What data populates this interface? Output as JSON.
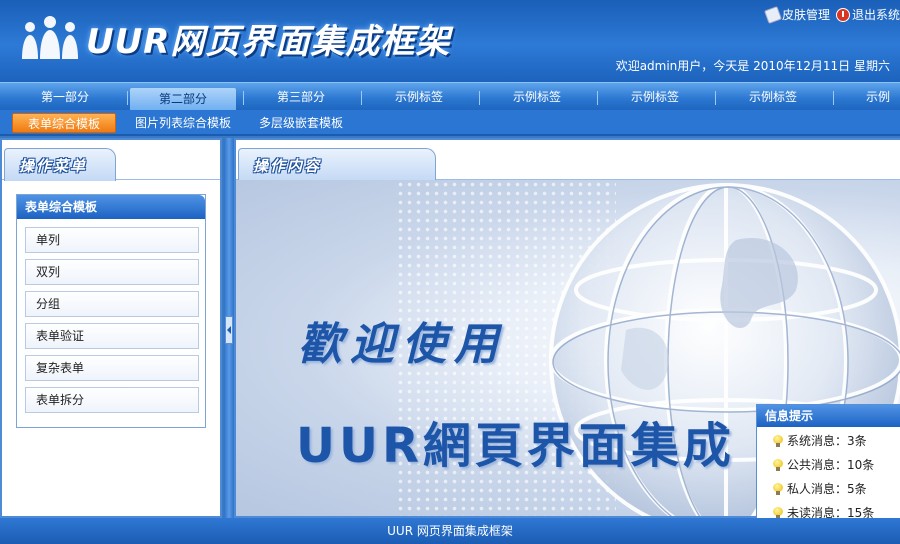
{
  "header": {
    "logo_text": "UUR网页界面集成框架",
    "skin_label": "皮肤管理",
    "logout_label": "退出系统",
    "welcome_text": "欢迎admin用户，今天是 2010年12月11日 星期六"
  },
  "main_nav": {
    "tabs": [
      {
        "label": "第一部分"
      },
      {
        "label": "第二部分"
      },
      {
        "label": "第三部分"
      },
      {
        "label": "示例标签"
      },
      {
        "label": "示例标签"
      },
      {
        "label": "示例标签"
      },
      {
        "label": "示例标签"
      },
      {
        "label": "示例标签"
      }
    ],
    "active_index": 1
  },
  "sub_nav": {
    "tabs": [
      {
        "label": "表单综合模板"
      },
      {
        "label": "图片列表综合模板"
      },
      {
        "label": "多层级嵌套模板"
      }
    ],
    "active_index": 0
  },
  "left_panel": {
    "title": "操作菜单",
    "menu_title": "表单综合模板",
    "items": [
      {
        "label": "单列"
      },
      {
        "label": "双列"
      },
      {
        "label": "分组"
      },
      {
        "label": "表单验证"
      },
      {
        "label": "复杂表单"
      },
      {
        "label": "表单拆分"
      }
    ]
  },
  "right_panel": {
    "title": "操作内容",
    "welcome_line1": "歡迎使用",
    "welcome_line2": "UUR網頁界面集成"
  },
  "info_tip": {
    "title": "信息提示",
    "items": [
      {
        "label": "系统消息：3条"
      },
      {
        "label": "公共消息：10条"
      },
      {
        "label": "私人消息：5条"
      },
      {
        "label": "未读消息：15条"
      }
    ]
  },
  "footer": {
    "text": "UUR 网页界面集成框架"
  },
  "colors": {
    "brand_blue": "#2a76d0",
    "active_subtab": "#f07a10",
    "welcome_text": "#1d55a8"
  }
}
